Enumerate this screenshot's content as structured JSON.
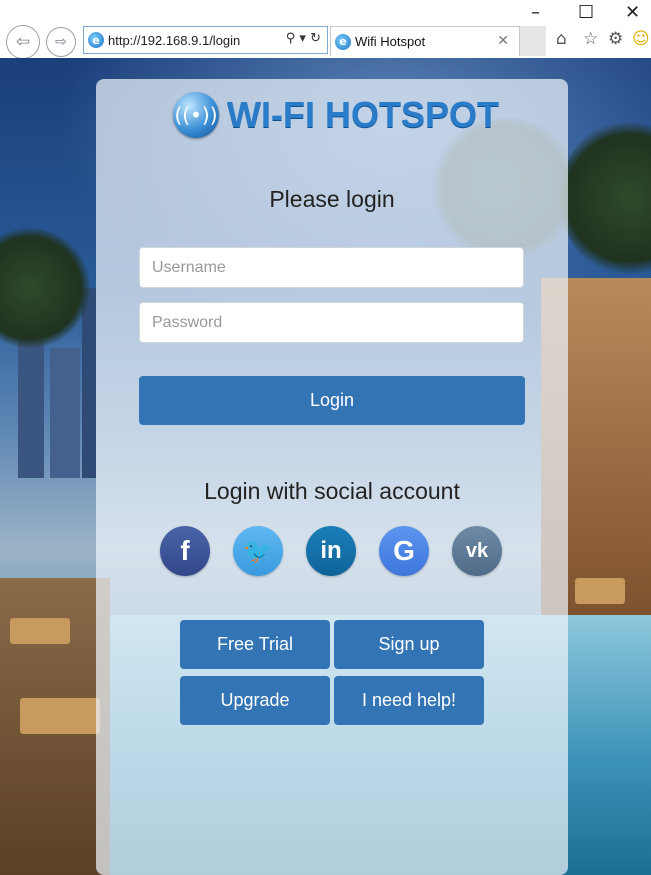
{
  "browser": {
    "address_url": "http://192.168.9.1/login",
    "tab_title": "Wifi Hotspot",
    "icons": {
      "back": "back-arrow-icon",
      "forward": "forward-arrow-icon",
      "search": "search-icon",
      "refresh": "refresh-icon",
      "home": "home-icon",
      "favorites": "star-icon",
      "settings": "gear-icon",
      "feedback": "smiley-icon"
    }
  },
  "login": {
    "logo_text": "WI-FI HOTSPOT",
    "heading": "Please login",
    "username_placeholder": "Username",
    "password_placeholder": "Password",
    "login_button": "Login",
    "social_heading": "Login with social account",
    "social": [
      {
        "name": "facebook",
        "glyph": "f"
      },
      {
        "name": "twitter",
        "glyph": "🐦"
      },
      {
        "name": "linkedin",
        "glyph": "in"
      },
      {
        "name": "google",
        "glyph": "G"
      },
      {
        "name": "vk",
        "glyph": "vk"
      }
    ],
    "buttons": {
      "free_trial": "Free Trial",
      "sign_up": "Sign up",
      "upgrade": "Upgrade",
      "help": "I need help!"
    }
  },
  "colors": {
    "button_blue": "#3374b5",
    "logo_blue": "#2a7cc9"
  }
}
